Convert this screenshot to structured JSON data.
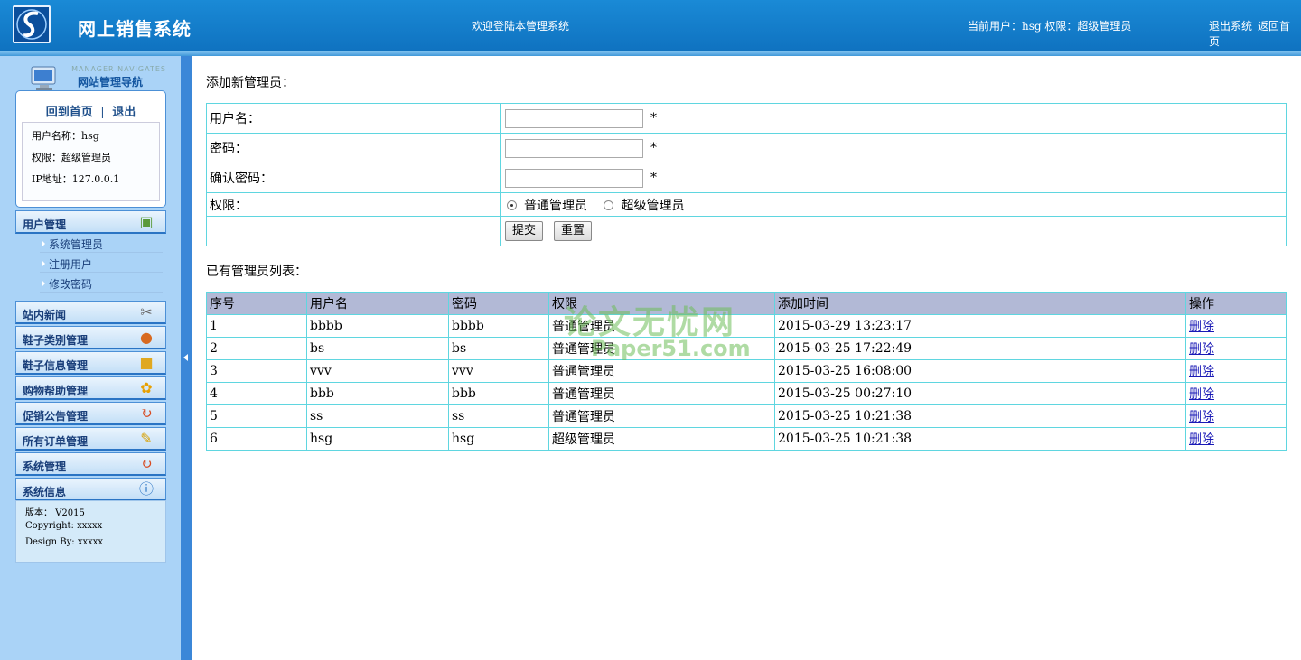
{
  "header": {
    "title": "网上销售系统",
    "welcome": "欢迎登陆本管理系统",
    "current_user": "当前用户：hsg 权限：超级管理员",
    "logout": "退出系统",
    "home": "返回首页"
  },
  "sidebar": {
    "nav_en": "MANAGER NAVIGATES",
    "nav_title": "网站管理导航",
    "home_link": "回到首页",
    "separator": "|",
    "exit_link": "退出",
    "user_name": "用户名称：hsg",
    "permission": "权限：超级管理员",
    "ip": "IP地址：127.0.0.1",
    "groups": [
      {
        "label": "用户管理",
        "icon": "user-card-icon"
      },
      {
        "label": "站内新闻",
        "icon": "tools-icon"
      },
      {
        "label": "鞋子类别管理",
        "icon": "users-icon"
      },
      {
        "label": "鞋子信息管理",
        "icon": "lock-icon"
      },
      {
        "label": "购物帮助管理",
        "icon": "gears-icon"
      },
      {
        "label": "促销公告管理",
        "icon": "refresh-icon"
      },
      {
        "label": "所有订单管理",
        "icon": "edit-icon"
      },
      {
        "label": "系统管理",
        "icon": "refresh-icon"
      },
      {
        "label": "系统信息",
        "icon": "info-window-icon"
      }
    ],
    "sub_items": [
      "系统管理员",
      "注册用户",
      "修改密码"
    ],
    "version": "版本： V2015",
    "copyright": "Copyright: xxxxx",
    "design": "Design By:  xxxxx"
  },
  "form": {
    "section_title": "添加新管理员：",
    "username_label": "用户名：",
    "password_label": "密码：",
    "confirm_label": "确认密码：",
    "permission_label": "权限：",
    "required_mark": "*",
    "radio_normal": "普通管理员",
    "radio_super": "超级管理员",
    "submit": "提交",
    "reset": "重置"
  },
  "list": {
    "section_title": "已有管理员列表：",
    "headers": [
      "序号",
      "用户名",
      "密码",
      "权限",
      "添加时间",
      "操作"
    ],
    "rows": [
      [
        "1",
        "bbbb",
        "bbbb",
        "普通管理员",
        "2015-03-29 13:23:17",
        "删除"
      ],
      [
        "2",
        "bs",
        "bs",
        "普通管理员",
        "2015-03-25 17:22:49",
        "删除"
      ],
      [
        "3",
        "vvv",
        "vvv",
        "普通管理员",
        "2015-03-25 16:08:00",
        "删除"
      ],
      [
        "4",
        "bbb",
        "bbb",
        "普通管理员",
        "2015-03-25 00:27:10",
        "删除"
      ],
      [
        "5",
        "ss",
        "ss",
        "普通管理员",
        "2015-03-25 10:21:38",
        "删除"
      ],
      [
        "6",
        "hsg",
        "hsg",
        "超级管理员",
        "2015-03-25 10:21:38",
        "删除"
      ]
    ]
  },
  "watermark": {
    "line1": "论文无忧网",
    "line2": "Paper51.com"
  },
  "colors": {
    "header": "#1580cc",
    "sidebar": "#aad3f7",
    "table_border": "#5fd6e0",
    "table_head": "#b2b9d6"
  }
}
